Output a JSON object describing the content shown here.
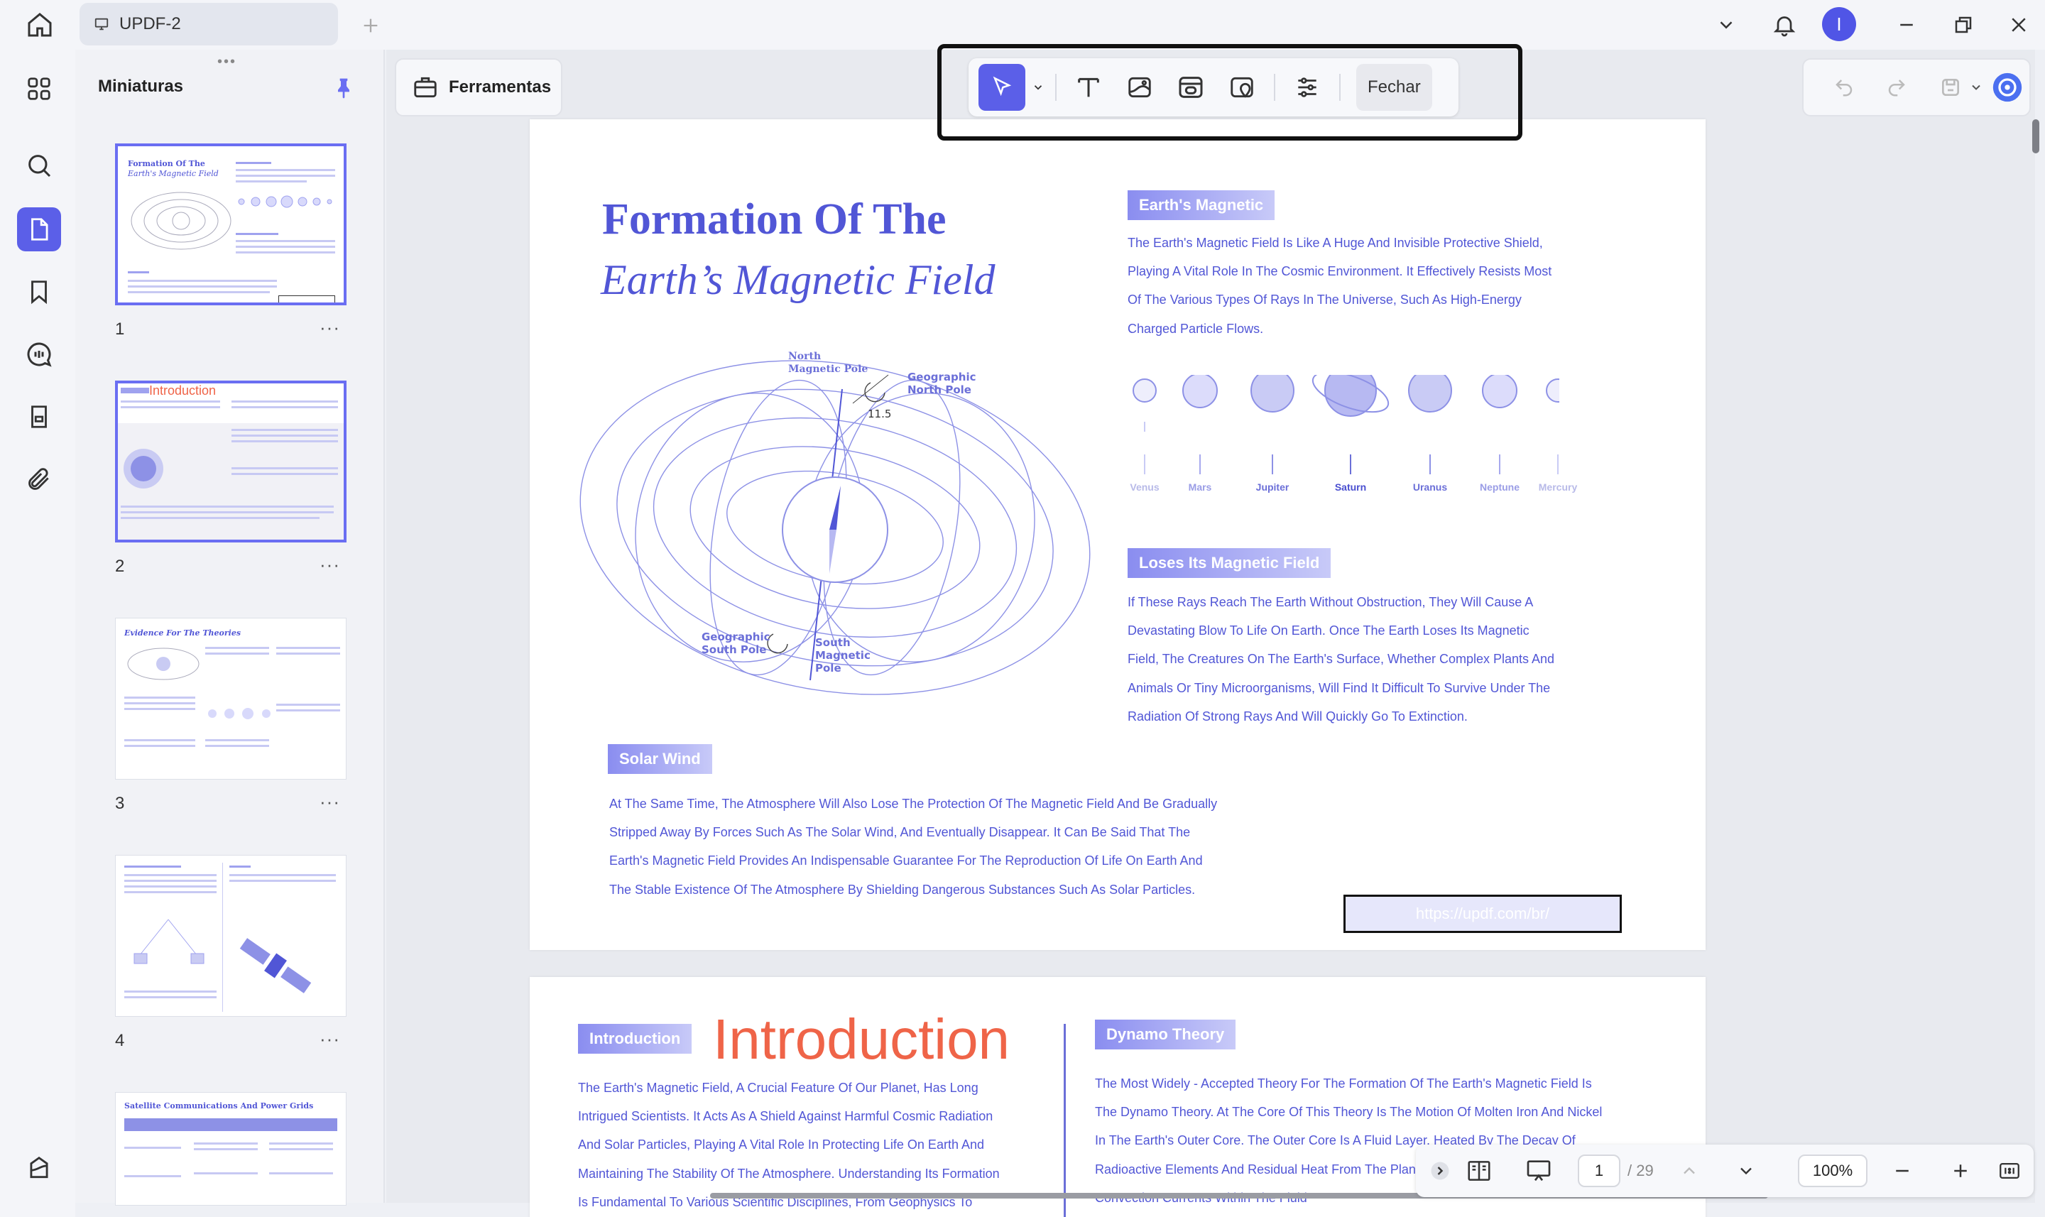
{
  "tab": {
    "title": "UPDF-2"
  },
  "user": {
    "initial": "I"
  },
  "thumbnails": {
    "title": "Miniaturas",
    "pages": [
      {
        "num": "1",
        "title": "Formation Of The"
      },
      {
        "num": "2",
        "title": "Introduction"
      },
      {
        "num": "3",
        "title": "Evidence For The Theories"
      },
      {
        "num": "4",
        "title": ""
      },
      {
        "num": "",
        "title": "Satellite Communications And Power Grids"
      }
    ]
  },
  "toolbar": {
    "tools_label": "Ferramentas",
    "close_label": "Fechar"
  },
  "page1": {
    "title_line1": "Formation Of The",
    "title_line2": "Earth’s Magnetic Field",
    "diagram": {
      "north_mag": "North\nMagnetic Pole",
      "geo_north": "Geographic\nNorth Pole",
      "angle": "11.5",
      "geo_south": "Geographic\nSouth Pole",
      "south_mag": "South\nMagnetic\nPole"
    },
    "earth_magnetic": {
      "heading": "Earth's Magnetic",
      "lines": [
        "The Earth's Magnetic Field Is Like A Huge And Invisible Protective Shield,",
        "Playing A Vital Role In The Cosmic Environment. It Effectively Resists Most",
        "Of The Various Types Of Rays In The Universe, Such As High-Energy",
        "Charged Particle Flows."
      ]
    },
    "planets": [
      "Venus",
      "Mars",
      "Jupiter",
      "Saturn",
      "Uranus",
      "Neptune",
      "Mercury"
    ],
    "loses": {
      "heading": "Loses Its Magnetic Field",
      "lines": [
        "If These Rays Reach The Earth Without Obstruction, They Will Cause A",
        "Devastating Blow To Life On Earth. Once The Earth Loses Its Magnetic",
        "Field, The Creatures On The Earth's Surface, Whether Complex Plants And",
        "Animals Or Tiny Microorganisms, Will Find It Difficult To Survive Under The",
        "Radiation Of Strong Rays And Will Quickly Go To Extinction."
      ]
    },
    "solar_wind": {
      "heading": "Solar Wind",
      "lines": [
        "At The Same Time, The Atmosphere Will Also Lose The Protection Of The Magnetic Field And Be Gradually",
        "Stripped Away By Forces Such As The Solar Wind, And Eventually Disappear. It Can Be Said That The",
        "Earth's Magnetic Field Provides An Indispensable Guarantee For The Reproduction Of Life On Earth And",
        "The Stable Existence Of The Atmosphere By Shielding Dangerous Substances Such As Solar Particles."
      ]
    },
    "link": "https://updf.com/br/"
  },
  "page2": {
    "intro_badge": "Introduction",
    "intro_big": "Introduction",
    "intro_lines": [
      "The Earth's Magnetic Field, A Crucial Feature Of Our Planet, Has Long",
      "Intrigued Scientists. It Acts As A Shield Against Harmful Cosmic Radiation",
      "And Solar Particles, Playing A Vital Role In Protecting Life On Earth And",
      "Maintaining The Stability Of The Atmosphere. Understanding Its Formation",
      "Is Fundamental To Various Scientific Disciplines, From Geophysics To"
    ],
    "dynamo_heading": "Dynamo Theory",
    "dynamo_lines": [
      "The Most Widely - Accepted Theory For The Formation Of The Earth's Magnetic Field Is",
      "The Dynamo Theory. At The Core Of This Theory Is The Motion Of Molten Iron And Nickel",
      "In The Earth's Outer Core. The Outer Core Is A Fluid Layer, Heated By The Decay Of",
      "Radioactive Elements And Residual Heat From The Planet's Formation. This Heat Creates",
      "Convection Currents Within The Fluid"
    ]
  },
  "nav": {
    "page": "1",
    "total": "/ 29",
    "zoom": "100%"
  }
}
